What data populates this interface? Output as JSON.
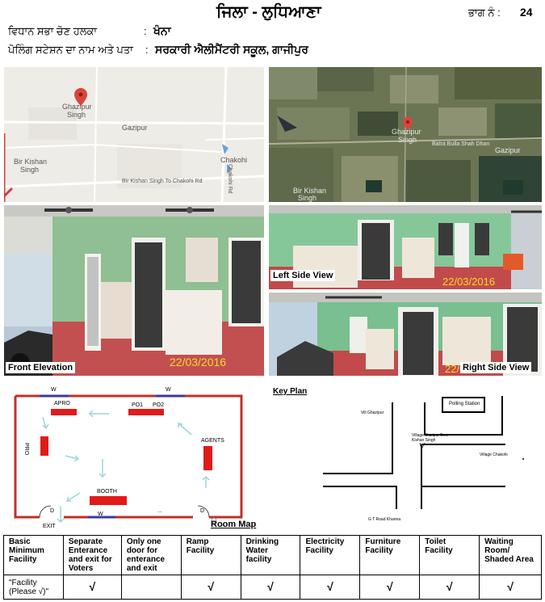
{
  "header": {
    "district": "ਜਿਲਾ - ਲੁਧਿਆਣਾ",
    "part_label": "ਭਾਗ ਨੰ :",
    "part_no": "24",
    "constituency_label": "ਵਿਧਾਨ ਸਭਾ ਚੋਣ ਹਲਕਾ",
    "constituency_colon": ":",
    "constituency_value": "ਖੰਨਾ",
    "station_label": "ਪੋਲਿੰਗ ਸਟੇਸ਼ਨ ਦਾ ਨਾਮ ਅਤੇ ਪਤਾ",
    "station_colon": ":",
    "station_value": "ਸਰਕਾਰੀ ਐਲੀਮੈਂਟਰੀ ਸਕੂਲ, ਗਾਜੀਪੁਰ"
  },
  "map": {
    "place_ghazipur": [
      "Ghazipur",
      "Singh"
    ],
    "place_gazipur": "Gazipur",
    "place_chakohi": "Chakohi",
    "place_bir_kishan": [
      "Bir Kishan",
      "Singh"
    ],
    "road": "Bir Kishan Singh To Chakohi Rd",
    "road_vertical": "Chakohi Rd"
  },
  "satellite": {
    "place_ghazipur": [
      "Ghazipur",
      "Singh"
    ],
    "place_batra": "Batra Bulla Shah Dhan",
    "place_gazipur": "Gazipur",
    "place_bir": [
      "Bir Kishan",
      "Singh"
    ]
  },
  "photos": {
    "front_label": "Front Elevation",
    "left_label": "Left Side View",
    "right_label": "Right Side View",
    "date": "22/03/2016"
  },
  "room_map": {
    "title": "Room Map",
    "w_top_left": "W",
    "w_top_right": "W",
    "w_bottom": "W",
    "apro": "APRO",
    "po1": "PO1",
    "po2": "PO2",
    "pro": "PRO",
    "agents": "AGENTS",
    "booth": "BOOTH",
    "door_left": "D",
    "door_right": "D",
    "exit": "EXIT",
    "dots": "..."
  },
  "key_plan": {
    "title": "Key Plan",
    "polling_station": "Polling Station",
    "vill_ghazipur": "Vill Ghazipur",
    "village_gazipur_beer": [
      "Village Gazipur Beer",
      "Kishan Singh"
    ],
    "village_chakohi": "Village Chakohi",
    "gt_road": "G T Road Khanna"
  },
  "facilities": {
    "headers": [
      [
        "Basic",
        "Minimum",
        "Facility"
      ],
      [
        "Separate",
        "Enterance",
        "and exit for",
        "Voters"
      ],
      [
        "Only one",
        "door for",
        "enterance",
        "and exit"
      ],
      [
        "Ramp",
        "Facility"
      ],
      [
        "Drinking",
        "Water",
        "facility"
      ],
      [
        "Electricity",
        "Facility"
      ],
      [
        "Furniture",
        "Facility"
      ],
      [
        "Toilet",
        "Facility"
      ],
      [
        "Waiting",
        "Room/",
        "Shaded Area"
      ]
    ],
    "row_label": [
      "\"Facility",
      "(Please √)\""
    ],
    "ticks": [
      "√",
      "",
      "√",
      "√",
      "√",
      "√",
      "√",
      "√"
    ]
  },
  "colors": {
    "map_road": "#ffffff",
    "map_pin": "#d9453b",
    "room_wall": "#c0302a",
    "room_furniture": "#e11a1a",
    "room_window": "#3a3aa8",
    "room_arrow": "#9fd4dc",
    "photo_date": "#f2dc2a"
  }
}
